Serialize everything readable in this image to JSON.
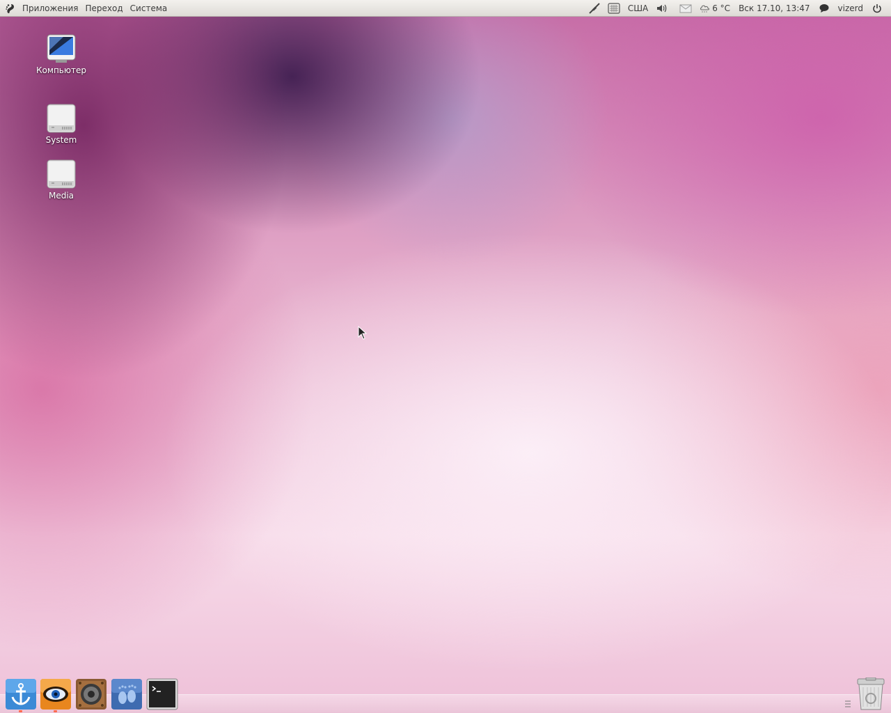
{
  "top_panel": {
    "menus": [
      "Приложения",
      "Переход",
      "Система"
    ],
    "keyboard_layout": "США",
    "weather": "6 °C",
    "datetime": "Вск 17.10, 13:47",
    "username": "vizerd"
  },
  "desktop": {
    "icons": [
      {
        "label": "Компьютер",
        "icon": "computer-icon"
      },
      {
        "label": "System",
        "icon": "drive-icon"
      },
      {
        "label": "Media",
        "icon": "drive-icon"
      }
    ]
  },
  "dock": {
    "items": [
      "anchor-icon",
      "eye-icon",
      "speaker-icon",
      "footprints-icon",
      "terminal-icon"
    ],
    "trash": "trash-icon"
  },
  "colors": {
    "panel": "#dedbd6",
    "panel_text": "#3c3c3c",
    "accent_dot": "#ff6a4c"
  }
}
